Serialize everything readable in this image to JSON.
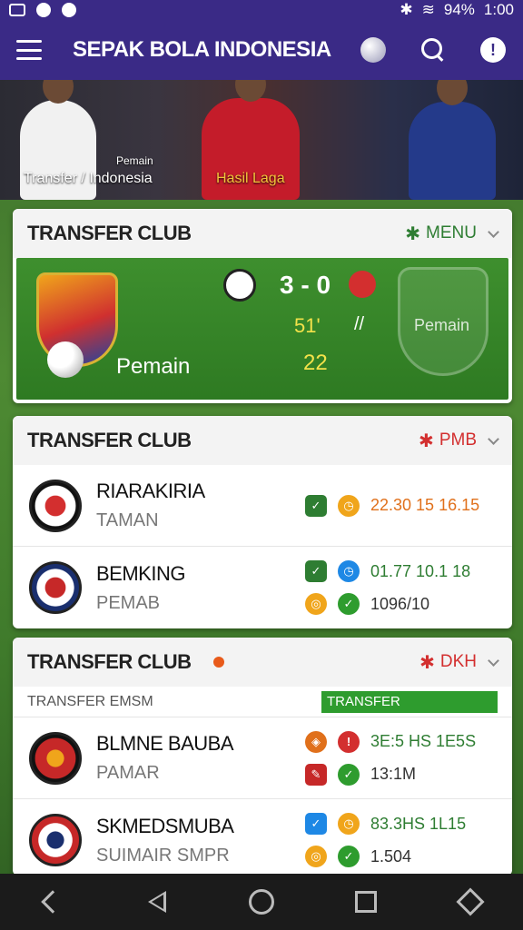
{
  "status_bar": {
    "battery": "94%",
    "time": "1:00"
  },
  "app_bar": {
    "title": "SEPAK BOLA INDONESIA"
  },
  "hero": {
    "caption_left": "Transfer / Indonesia",
    "caption_sub": "Pemain",
    "caption_right": "Hasil Laga"
  },
  "match_card": {
    "title": "TRANSFER CLUB",
    "action_label": "MENU",
    "score": "3 - 0",
    "mid_value": "51'",
    "vs_label": "//",
    "bottom_value": "22",
    "team_name": "Pemain",
    "ghost_label": "Pemain"
  },
  "club_card_1": {
    "title": "TRANSFER CLUB",
    "action_label": "PMB",
    "rows": [
      {
        "name": "RIARAKIRIA",
        "sub": "TAMAN",
        "stat1": "22.30 15 16.15",
        "stat1_color": "orange"
      },
      {
        "name": "BEMKING",
        "sub": "PEMAB",
        "stat1": "01.77 10.1 18",
        "stat2": "1096/10"
      }
    ]
  },
  "club_card_2": {
    "title": "TRANSFER CLUB",
    "action_label": "DKH",
    "strip_label": "TRANSFER EMSM",
    "strip_value": "TRANSFER",
    "rows": [
      {
        "name": "BLMNE BAUBA",
        "sub": "PAMAR",
        "stat1": "3E:5 HS 1E5S",
        "stat2": "13:1M"
      },
      {
        "name": "SKMEDSMUBA",
        "sub": "SUIMAIR SMPR",
        "stat1": "83.3HS 1L15",
        "stat2": "1.504"
      }
    ]
  },
  "icons": [
    "menu-icon",
    "ball-icon",
    "search-icon",
    "info-icon",
    "back-icon",
    "home-icon",
    "recents-icon"
  ],
  "colors": {
    "primary": "#3a2a86",
    "accent_red": "#d32f2f",
    "accent_green": "#2e7d32"
  }
}
